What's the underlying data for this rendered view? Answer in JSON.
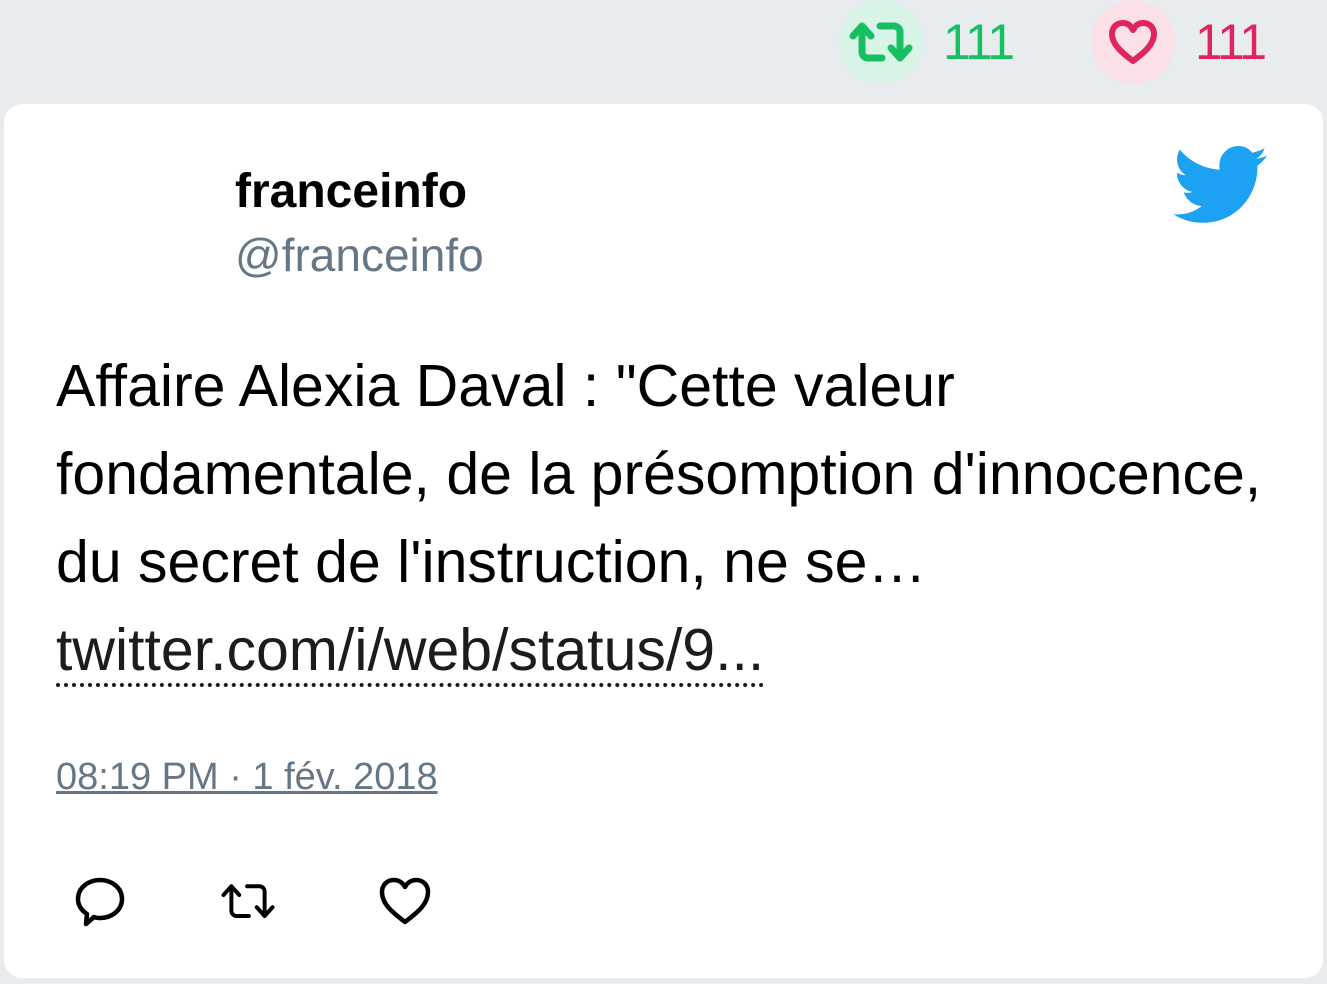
{
  "stats": {
    "retweet_count": "111",
    "like_count": "111",
    "retweet_color": "#17bf63",
    "like_color": "#e0245e"
  },
  "tweet": {
    "display_name": "franceinfo",
    "handle": "@franceinfo",
    "text": "Affaire Alexia Daval : \"Cette valeur fondamentale, de la présomption d'innocence, du secret de l'instruction, ne se… ",
    "link_text": "twitter.com/i/web/status/9...",
    "timestamp": "08:19 PM · 1 fév. 2018",
    "brand_icon": "twitter-bird-icon",
    "brand_color": "#1da1f2"
  },
  "actions": [
    {
      "icon": "reply-icon"
    },
    {
      "icon": "retweet-icon"
    },
    {
      "icon": "like-icon"
    }
  ]
}
